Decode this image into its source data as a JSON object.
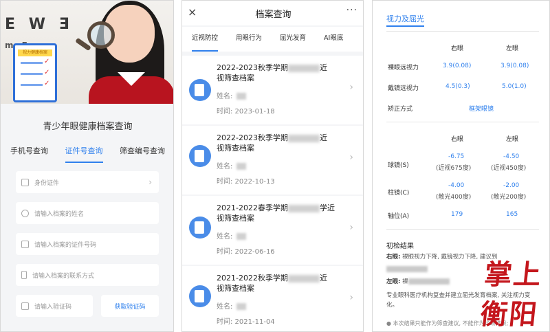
{
  "panel1": {
    "title": "青少年眼健康档案查询",
    "clipboard_label": "视力健康档案",
    "eye_chart_row1": "E W Ǝ",
    "eye_chart_row2": "m E w",
    "tabs": [
      {
        "label": "手机号查询",
        "active": false
      },
      {
        "label": "证件号查询",
        "active": true
      },
      {
        "label": "筛查编号查询",
        "active": false
      }
    ],
    "fields": {
      "id_type": "身份证件",
      "name": "请输入档案的姓名",
      "id_number": "请输入档案的证件号码",
      "phone": "请输入档案的联系方式",
      "code": "请输入验证码"
    },
    "get_code_label": "获取验证码"
  },
  "panel2": {
    "header_title": "档案查询",
    "close_glyph": "×",
    "more_glyph": "···",
    "tabs": [
      {
        "label": "近视防控",
        "active": true
      },
      {
        "label": "用眼行为",
        "active": false
      },
      {
        "label": "屈光发育",
        "active": false
      },
      {
        "label": "AI眼底",
        "active": false
      }
    ],
    "records": [
      {
        "title_a": "2022-2023秋季学期",
        "title_b": "近",
        "title_c": "视筛查档案",
        "name_label": "姓名:",
        "time": "时间:  2023-01-18"
      },
      {
        "title_a": "2022-2023秋季学期",
        "title_b": "近",
        "title_c": "视筛查档案",
        "name_label": "姓名:",
        "time": "时间:  2022-10-13"
      },
      {
        "title_a": "2021-2022春季学期",
        "title_b": "学近",
        "title_c": "视筛查档案",
        "name_label": "姓名:",
        "time": "时间:  2022-06-16"
      },
      {
        "title_a": "2021-2022秋季学期",
        "title_b": "近",
        "title_c": "视筛查档案",
        "name_label": "姓名:",
        "time": "时间:  2021-11-04"
      }
    ]
  },
  "panel3": {
    "section_title": "视力及屈光",
    "col_right": "右眼",
    "col_left": "左眼",
    "vision_rows": [
      {
        "label": "裸眼远视力",
        "right": "3.9(0.08)",
        "left": "3.9(0.08)"
      },
      {
        "label": "戴镜远视力",
        "right": "4.5(0.3)",
        "left": "5.0(1.0)"
      }
    ],
    "correction_label": "矫正方式",
    "correction_value": "框架眼镜",
    "refraction_rows": [
      {
        "label": "球镜(S)",
        "right_val": "-6.75",
        "right_sub": "(近视675度)",
        "left_val": "-4.50",
        "left_sub": "(近视450度)"
      },
      {
        "label": "柱镜(C)",
        "right_val": "-4.00",
        "right_sub": "(散光400度)",
        "left_val": "-2.00",
        "left_sub": "(散光200度)"
      },
      {
        "label": "轴位(A)",
        "right_val": "179",
        "right_sub": "",
        "left_val": "165",
        "left_sub": ""
      }
    ],
    "result_title": "初检结果",
    "result_right_label": "右眼:",
    "result_right_text": "裸眼视力下降, 戴镜视力下降, 建议到",
    "result_left_label": "左眼:",
    "result_left_text": "裸",
    "result_cont": "专业眼科医疗机构复查并建立屈光发育档案, 关注视力变化。",
    "footnote": "● 本次结果只能作为筛查建议, 不能作为诊断结果;",
    "watermark": "掌上衡阳"
  }
}
